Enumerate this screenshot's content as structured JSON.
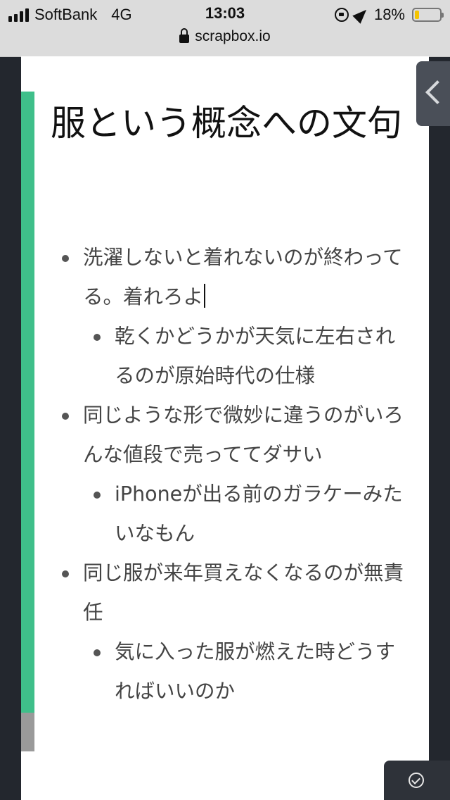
{
  "status_bar": {
    "carrier": "SoftBank",
    "network": "4G",
    "time": "13:03",
    "battery": "18%",
    "battery_level": 0.18,
    "url": "scrapbox.io",
    "icons": [
      "signal-icon",
      "orientation-lock-icon",
      "location-icon",
      "battery-icon",
      "lock-icon"
    ]
  },
  "page": {
    "title": "服という概念への文句",
    "bullets": [
      {
        "level": 1,
        "text": "洗濯しないと着れないのが終わってる。着れろよ",
        "cursor": true
      },
      {
        "level": 2,
        "text": "乾くかどうかが天気に左右されるのが原始時代の仕様"
      },
      {
        "level": 1,
        "text": "同じような形で微妙に違うのがいろんな値段で売っててダサい"
      },
      {
        "level": 2,
        "text": "iPhoneが出る前のガラケーみたいなもん"
      },
      {
        "level": 1,
        "text": "同じ服が来年買えなくなるのが無責任"
      },
      {
        "level": 2,
        "text": "気に入った服が燃えた時どうすればいいのか"
      }
    ]
  },
  "controls": {
    "side_toggle_icon": "chevron-left-icon",
    "bottom_icon": "check-circle-icon"
  },
  "colors": {
    "accent": "#3fbf8a",
    "background": "#23272e",
    "page": "#ffffff",
    "battery_fill": "#f5c400"
  }
}
